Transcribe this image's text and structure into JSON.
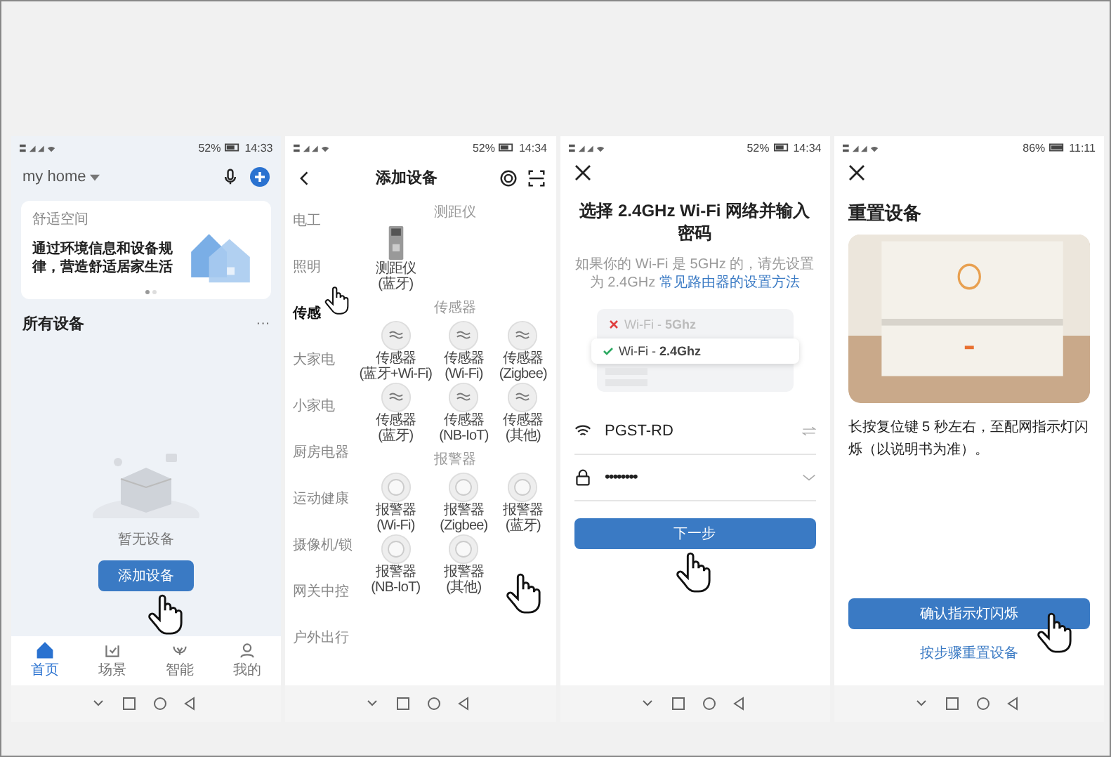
{
  "home_screen": {
    "status_bar": {
      "battery": "52%",
      "time": "14:33"
    },
    "home_name": "my home",
    "banner": {
      "label": "舒适空间",
      "text": "通过环境信息和设备规律，营造舒适居家生活"
    },
    "section_title": "所有设备",
    "more": "···",
    "empty_text": "暂无设备",
    "add_button": "添加设备",
    "tabs": [
      {
        "label": "首页",
        "selected": true,
        "kind": "home"
      },
      {
        "label": "场景",
        "selected": false,
        "kind": "scene"
      },
      {
        "label": "智能",
        "selected": false,
        "kind": "smart"
      },
      {
        "label": "我的",
        "selected": false,
        "kind": "me"
      }
    ]
  },
  "add_device_screen": {
    "status_bar": {
      "battery": "52%",
      "time": "14:34"
    },
    "title": "添加设备",
    "categories": [
      {
        "label": "电工",
        "selected": false
      },
      {
        "label": "照明",
        "selected": false
      },
      {
        "label": "传感",
        "selected": true
      },
      {
        "label": "大家电",
        "selected": false
      },
      {
        "label": "小家电",
        "selected": false
      },
      {
        "label": "厨房电器",
        "selected": false
      },
      {
        "label": "运动健康",
        "selected": false
      },
      {
        "label": "摄像机/锁",
        "selected": false
      },
      {
        "label": "网关中控",
        "selected": false
      },
      {
        "label": "户外出行",
        "selected": false
      }
    ],
    "sections": [
      {
        "title": "测距仪",
        "kind": "rangefinder",
        "items": [
          {
            "name": "测距仪",
            "sub": "(蓝牙)"
          }
        ]
      },
      {
        "title": "传感器",
        "kind": "sensor",
        "items": [
          {
            "name": "传感器",
            "sub": "(蓝牙+Wi-Fi)"
          },
          {
            "name": "传感器",
            "sub": "(Wi-Fi)"
          },
          {
            "name": "传感器",
            "sub": "(Zigbee)"
          },
          {
            "name": "传感器",
            "sub": "(蓝牙)"
          },
          {
            "name": "传感器",
            "sub": "(NB-IoT)"
          },
          {
            "name": "传感器",
            "sub": "(其他)"
          }
        ]
      },
      {
        "title": "报警器",
        "kind": "alarm",
        "items": [
          {
            "name": "报警器",
            "sub": "(Wi-Fi)"
          },
          {
            "name": "报警器",
            "sub": "(Zigbee)"
          },
          {
            "name": "报警器",
            "sub": "(蓝牙)"
          },
          {
            "name": "报警器",
            "sub": "(NB-IoT)"
          },
          {
            "name": "报警器",
            "sub": "(其他)"
          }
        ]
      }
    ]
  },
  "wifi_screen": {
    "status_bar": {
      "battery": "52%",
      "time": "14:34"
    },
    "title": "选择 2.4GHz Wi-Fi 网络并输入密码",
    "hint": "如果你的 Wi-Fi 是 5GHz 的，请先设置为 2.4GHz",
    "hint_link": "常见路由器的设置方法",
    "networks": [
      {
        "label": "Wi-Fi - **5Ghz**",
        "selected": false
      },
      {
        "label": "Wi-Fi - **2.4Ghz**",
        "selected": true
      }
    ],
    "network_name": "PGST-RD",
    "password": "••••••••",
    "next_button": "下一步"
  },
  "reset_screen": {
    "status_bar": {
      "battery": "86%",
      "time": "11:11"
    },
    "title": "重置设备",
    "instruction": "长按复位键 5 秒左右，至配网指示灯闪烁（以说明书为准）。",
    "confirm_button": "确认指示灯闪烁",
    "link": "按步骤重置设备"
  }
}
